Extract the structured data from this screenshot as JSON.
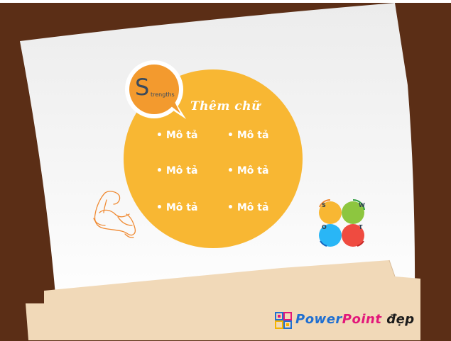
{
  "badge": {
    "letter": "S",
    "rest": "trengths"
  },
  "title": "Thêm chữ",
  "bullets": [
    "• Mô tả",
    "• Mô tả",
    "• Mô tả",
    "• Mô tả",
    "• Mô tả",
    "• Mô tả"
  ],
  "swot": {
    "s": "S",
    "w": "W",
    "o": "O",
    "t": "T"
  },
  "brand": {
    "part1": "Power",
    "part2": "Point",
    "part3": " đẹp"
  },
  "colors": {
    "background": "#5b2e16",
    "paper": "#f4f4f4",
    "circle": "#f8b733",
    "badge": "#f39a2e",
    "folder": "#f1d9b8",
    "swot_s": "#f8b733",
    "swot_w": "#8dc63f",
    "swot_o": "#29b6f6",
    "swot_t": "#ef4b40",
    "brand_blue": "#1f6fd1",
    "brand_pink": "#e2177a"
  },
  "icons": [
    "flexed-arm-icon",
    "swot-logo-icon",
    "powerpoint-logo-icon"
  ]
}
